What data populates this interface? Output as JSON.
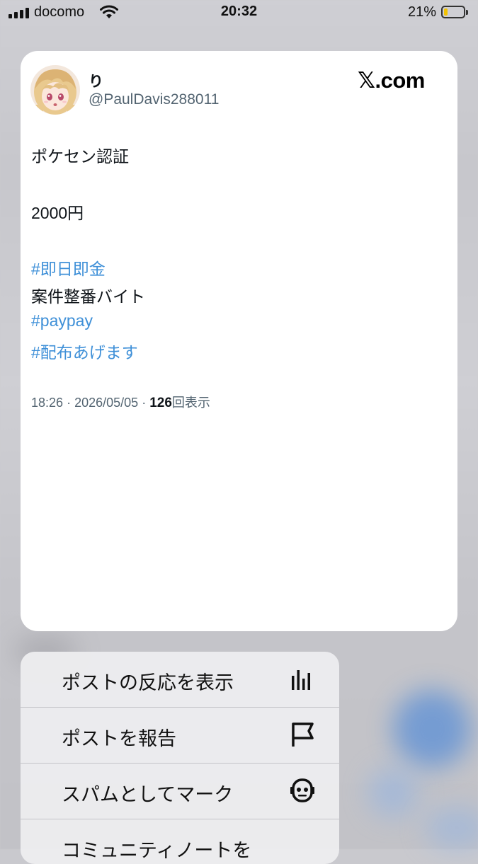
{
  "status_bar": {
    "carrier": "docomo",
    "time": "20:32",
    "battery_percent_label": "21%",
    "battery_level": 0.21,
    "signal_bars": 4
  },
  "post": {
    "display_name": "り",
    "handle": "@PaulDavis288011",
    "brand": "𝕏.com",
    "lines": {
      "line1": "ポケセン認証",
      "line2": "2000円",
      "hashtag1": "#即日即金",
      "line3": "案件整番バイト",
      "hashtag2": "#paypay",
      "hashtag3": "#配布あげます"
    },
    "time": "18:26",
    "date": "2026/05/05",
    "views_count": "126",
    "views_label": "回表示",
    "separator": "·"
  },
  "menu": {
    "items": [
      {
        "label": "ポストの反応を表示",
        "icon": "bar-chart-icon"
      },
      {
        "label": "ポストを報告",
        "icon": "flag-icon"
      },
      {
        "label": "スパムとしてマーク",
        "icon": "robot-icon"
      },
      {
        "label": "コミュニティノートを",
        "icon": ""
      }
    ]
  },
  "colors": {
    "hashtag": "#3f90d8",
    "battery_fill": "#f2c200",
    "meta_gray": "#536471"
  }
}
